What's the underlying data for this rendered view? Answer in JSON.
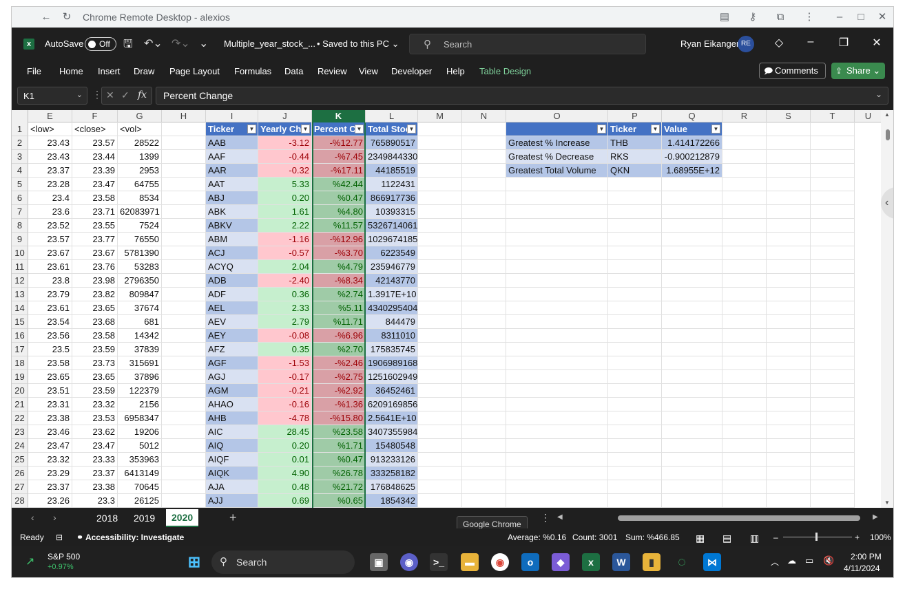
{
  "remote": {
    "title": "Chrome Remote Desktop - alexios"
  },
  "excel": {
    "autosave_label": "AutoSave",
    "autosave_state": "Off",
    "doc_name": "Multiple_year_stock_...",
    "saved_status": "• Saved to this PC",
    "search_placeholder": "Search",
    "user_name": "Ryan Eikanger",
    "user_initials": "RE"
  },
  "ribbon": {
    "tabs": [
      "File",
      "Home",
      "Insert",
      "Draw",
      "Page Layout",
      "Formulas",
      "Data",
      "Review",
      "View",
      "Developer",
      "Help",
      "Table Design"
    ],
    "comments_label": "Comments",
    "share_label": "Share"
  },
  "formula_bar": {
    "name_box": "K1",
    "formula": "Percent Change"
  },
  "columns": [
    "E",
    "F",
    "G",
    "H",
    "I",
    "J",
    "K",
    "L",
    "M",
    "N",
    "O",
    "P",
    "Q",
    "R",
    "S",
    "T",
    "U"
  ],
  "headers": {
    "E": "<low>",
    "F": "<close>",
    "G": "<vol>",
    "I": "Ticker",
    "J": "Yearly Ch",
    "K": "Percent C",
    "L": "Total Stoc",
    "O": "",
    "P": "Ticker",
    "Q": "Value"
  },
  "rows": [
    {
      "n": "2",
      "low": "23.43",
      "close": "23.57",
      "vol": "28522",
      "ticker": "AAB",
      "yc": "-3.12",
      "pc": "-%12.77",
      "ts": "765890517"
    },
    {
      "n": "3",
      "low": "23.43",
      "close": "23.44",
      "vol": "1399",
      "ticker": "AAF",
      "yc": "-0.44",
      "pc": "-%7.45",
      "ts": "2349844330"
    },
    {
      "n": "4",
      "low": "23.37",
      "close": "23.39",
      "vol": "2953",
      "ticker": "AAR",
      "yc": "-0.32",
      "pc": "-%17.11",
      "ts": "44185519"
    },
    {
      "n": "5",
      "low": "23.28",
      "close": "23.47",
      "vol": "64755",
      "ticker": "AAT",
      "yc": "5.33",
      "pc": "%42.44",
      "ts": "1122431"
    },
    {
      "n": "6",
      "low": "23.4",
      "close": "23.58",
      "vol": "8534",
      "ticker": "ABJ",
      "yc": "0.20",
      "pc": "%0.47",
      "ts": "866917736"
    },
    {
      "n": "7",
      "low": "23.6",
      "close": "23.71",
      "vol": "62083971",
      "ticker": "ABK",
      "yc": "1.61",
      "pc": "%4.80",
      "ts": "10393315"
    },
    {
      "n": "8",
      "low": "23.52",
      "close": "23.55",
      "vol": "7524",
      "ticker": "ABKV",
      "yc": "2.22",
      "pc": "%11.57",
      "ts": "5326714061"
    },
    {
      "n": "9",
      "low": "23.57",
      "close": "23.77",
      "vol": "76550",
      "ticker": "ABM",
      "yc": "-1.16",
      "pc": "-%12.96",
      "ts": "1029674185"
    },
    {
      "n": "10",
      "low": "23.67",
      "close": "23.67",
      "vol": "5781390",
      "ticker": "ACJ",
      "yc": "-0.57",
      "pc": "-%3.70",
      "ts": "6223549"
    },
    {
      "n": "11",
      "low": "23.61",
      "close": "23.76",
      "vol": "53283",
      "ticker": "ACYQ",
      "yc": "2.04",
      "pc": "%4.79",
      "ts": "235946779"
    },
    {
      "n": "12",
      "low": "23.8",
      "close": "23.98",
      "vol": "2796350",
      "ticker": "ADB",
      "yc": "-2.40",
      "pc": "-%8.34",
      "ts": "42143770"
    },
    {
      "n": "13",
      "low": "23.79",
      "close": "23.82",
      "vol": "809847",
      "ticker": "ADF",
      "yc": "0.36",
      "pc": "%2.74",
      "ts": "1.3917E+10"
    },
    {
      "n": "14",
      "low": "23.61",
      "close": "23.65",
      "vol": "37674",
      "ticker": "AEL",
      "yc": "2.33",
      "pc": "%5.11",
      "ts": "4340295404"
    },
    {
      "n": "15",
      "low": "23.54",
      "close": "23.68",
      "vol": "681",
      "ticker": "AEV",
      "yc": "2.79",
      "pc": "%11.71",
      "ts": "844479"
    },
    {
      "n": "16",
      "low": "23.56",
      "close": "23.58",
      "vol": "14342",
      "ticker": "AEY",
      "yc": "-0.08",
      "pc": "-%6.96",
      "ts": "8311010"
    },
    {
      "n": "17",
      "low": "23.5",
      "close": "23.59",
      "vol": "37839",
      "ticker": "AFZ",
      "yc": "0.35",
      "pc": "%2.70",
      "ts": "175835745"
    },
    {
      "n": "18",
      "low": "23.58",
      "close": "23.73",
      "vol": "315691",
      "ticker": "AGF",
      "yc": "-1.53",
      "pc": "-%2.46",
      "ts": "1906989168"
    },
    {
      "n": "19",
      "low": "23.65",
      "close": "23.65",
      "vol": "37896",
      "ticker": "AGJ",
      "yc": "-0.17",
      "pc": "-%2.75",
      "ts": "1251602949"
    },
    {
      "n": "20",
      "low": "23.51",
      "close": "23.59",
      "vol": "122379",
      "ticker": "AGM",
      "yc": "-0.21",
      "pc": "-%2.92",
      "ts": "36452461"
    },
    {
      "n": "21",
      "low": "23.31",
      "close": "23.32",
      "vol": "2156",
      "ticker": "AHAO",
      "yc": "-0.16",
      "pc": "-%1.36",
      "ts": "6209169856"
    },
    {
      "n": "22",
      "low": "23.38",
      "close": "23.53",
      "vol": "6958347",
      "ticker": "AHB",
      "yc": "-4.78",
      "pc": "-%15.80",
      "ts": "2.5641E+10"
    },
    {
      "n": "23",
      "low": "23.46",
      "close": "23.62",
      "vol": "19206",
      "ticker": "AIC",
      "yc": "28.45",
      "pc": "%23.58",
      "ts": "3407355984"
    },
    {
      "n": "24",
      "low": "23.47",
      "close": "23.47",
      "vol": "5012",
      "ticker": "AIQ",
      "yc": "0.20",
      "pc": "%1.71",
      "ts": "15480548"
    },
    {
      "n": "25",
      "low": "23.32",
      "close": "23.33",
      "vol": "353963",
      "ticker": "AIQF",
      "yc": "0.01",
      "pc": "%0.47",
      "ts": "913233126"
    },
    {
      "n": "26",
      "low": "23.29",
      "close": "23.37",
      "vol": "6413149",
      "ticker": "AIQK",
      "yc": "4.90",
      "pc": "%26.78",
      "ts": "333258182"
    },
    {
      "n": "27",
      "low": "23.37",
      "close": "23.38",
      "vol": "70645",
      "ticker": "AJA",
      "yc": "0.48",
      "pc": "%21.72",
      "ts": "176848625"
    },
    {
      "n": "28",
      "low": "23.26",
      "close": "23.3",
      "vol": "26125",
      "ticker": "AJJ",
      "yc": "0.69",
      "pc": "%0.65",
      "ts": "1854342"
    }
  ],
  "summary": [
    {
      "label": "Greatest % Increase",
      "ticker": "THB",
      "value": "1.414172266"
    },
    {
      "label": "Greatest % Decrease",
      "ticker": "RKS",
      "value": "-0.900212879"
    },
    {
      "label": "Greatest Total Volume",
      "ticker": "QKN",
      "value": "1.68955E+12"
    }
  ],
  "sheets": [
    "2018",
    "2019",
    "2020"
  ],
  "active_sheet": "2020",
  "tooltip": "Google Chrome",
  "status": {
    "ready": "Ready",
    "accessibility": "Accessibility: Investigate",
    "average": "Average: %0.16",
    "count": "Count: 3001",
    "sum": "Sum: %466.85",
    "zoom": "100%"
  },
  "taskbar": {
    "stock_name": "S&P 500",
    "stock_change": "+0.97%",
    "search_placeholder": "Search",
    "time": "2:00 PM",
    "date": "4/11/2024"
  },
  "colors": {
    "excel_green": "#1d6f42",
    "table_header": "#4472c4",
    "good_fill": "#c6efce",
    "bad_fill": "#ffc7ce"
  }
}
